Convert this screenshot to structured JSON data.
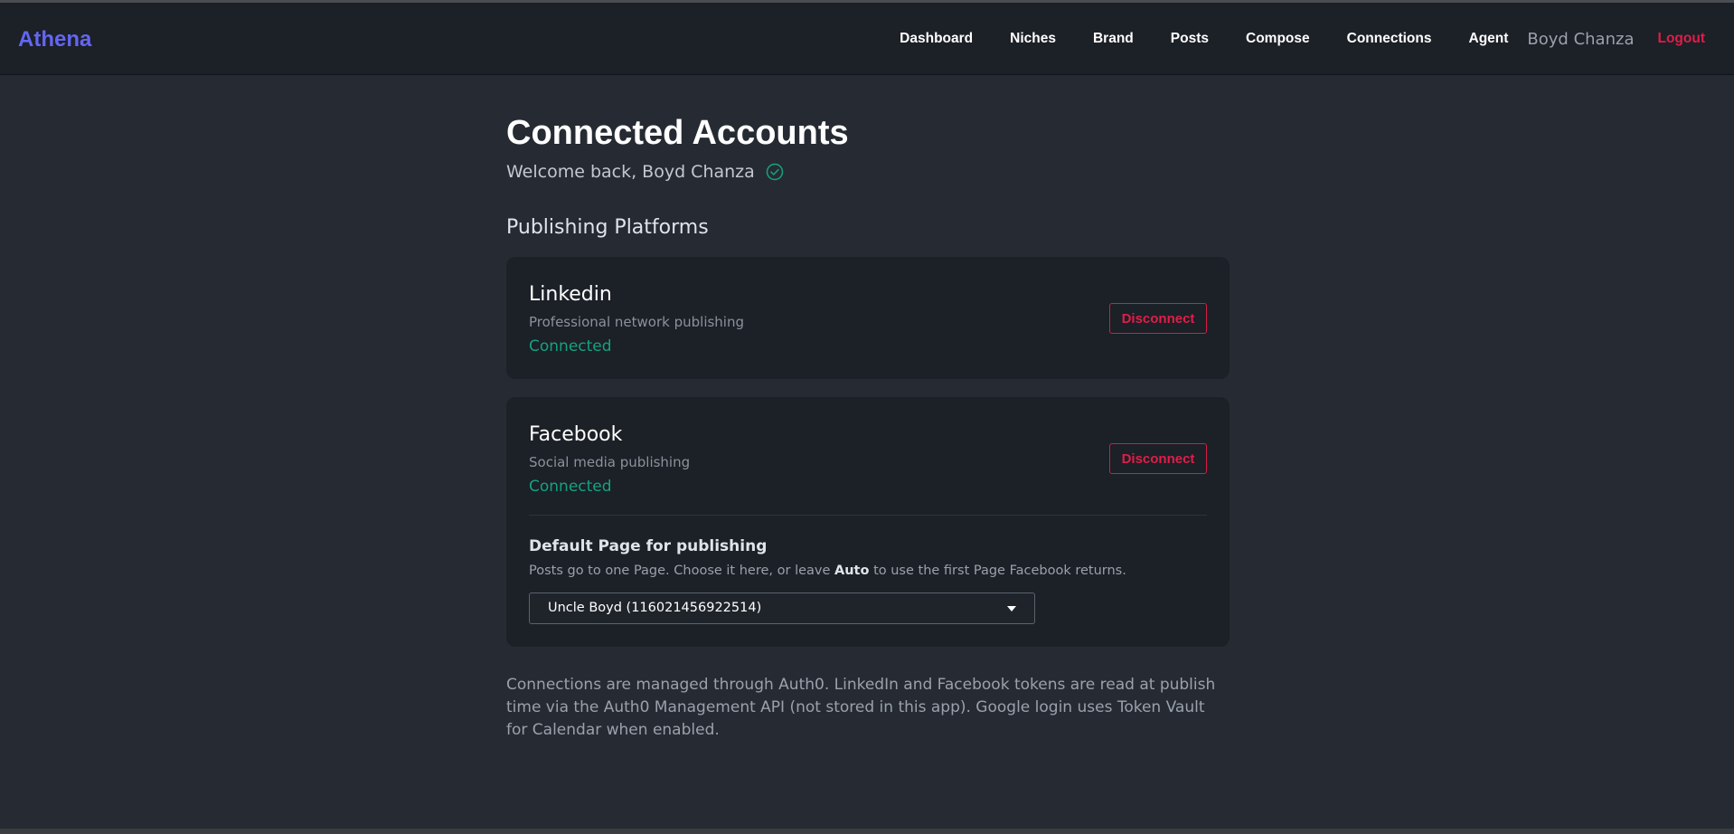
{
  "app": {
    "brand": "Athena"
  },
  "nav": {
    "items": [
      "Dashboard",
      "Niches",
      "Brand",
      "Posts",
      "Compose",
      "Connections",
      "Agent"
    ],
    "user": "Boyd Chanza",
    "logout": "Logout"
  },
  "colors": {
    "brand": "#6366f1",
    "danger": "#e11d48",
    "success": "#14a37f",
    "background": "#262b33",
    "card": "#1c2027"
  },
  "page": {
    "title": "Connected Accounts",
    "welcome": "Welcome back, Boyd Chanza",
    "welcome_icon": "check-circle-icon",
    "section_heading": "Publishing Platforms"
  },
  "platforms": [
    {
      "name": "Linkedin",
      "description": "Professional network publishing",
      "status": "Connected",
      "action": "Disconnect"
    },
    {
      "name": "Facebook",
      "description": "Social media publishing",
      "status": "Connected",
      "action": "Disconnect",
      "default_page": {
        "title": "Default Page for publishing",
        "help_before": "Posts go to one Page. Choose it here, or leave ",
        "help_bold": "Auto",
        "help_after": " to use the first Page Facebook returns.",
        "selected": "Uncle Boyd (116021456922514)",
        "select_icon": "caret-down-icon"
      }
    }
  ],
  "footer_note": "Connections are managed through Auth0. LinkedIn and Facebook tokens are read at publish time via the Auth0 Management API (not stored in this app). Google login uses Token Vault for Calendar when enabled."
}
